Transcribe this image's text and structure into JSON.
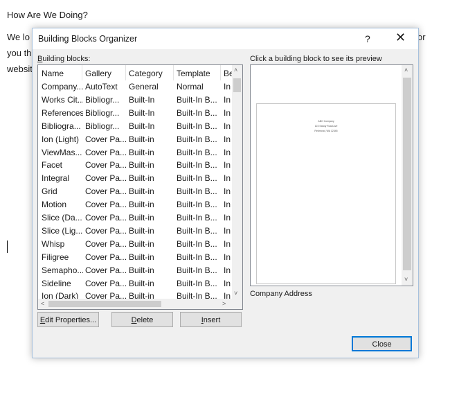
{
  "document": {
    "heading": "How Are We Doing?",
    "line1": "We lo",
    "line1_tail": "or",
    "line2": "you th",
    "line3": "websit"
  },
  "dialog": {
    "title": "Building Blocks Organizer",
    "help": "?",
    "close_glyph": "✕",
    "list_label_key": "B",
    "list_label_rest": "uilding blocks:",
    "preview_label": "Click a building block to see its preview",
    "columns": [
      "Name",
      "Gallery",
      "Category",
      "Template",
      "Be"
    ],
    "rows": [
      [
        "Company...",
        "AutoText",
        "General",
        "Normal",
        "In"
      ],
      [
        "Works Cit...",
        "Bibliogr...",
        "Built-In",
        "Built-In B...",
        "In"
      ],
      [
        "References",
        "Bibliogr...",
        "Built-In",
        "Built-In B...",
        "In"
      ],
      [
        "Bibliogra...",
        "Bibliogr...",
        "Built-In",
        "Built-In B...",
        "In"
      ],
      [
        "Ion (Light)",
        "Cover Pa...",
        "Built-in",
        "Built-In B...",
        "In"
      ],
      [
        "ViewMas...",
        "Cover Pa...",
        "Built-in",
        "Built-In B...",
        "In"
      ],
      [
        "Facet",
        "Cover Pa...",
        "Built-in",
        "Built-In B...",
        "In"
      ],
      [
        "Integral",
        "Cover Pa...",
        "Built-in",
        "Built-In B...",
        "In"
      ],
      [
        "Grid",
        "Cover Pa...",
        "Built-in",
        "Built-In B...",
        "In"
      ],
      [
        "Motion",
        "Cover Pa...",
        "Built-in",
        "Built-In B...",
        "In"
      ],
      [
        "Slice (Da...",
        "Cover Pa...",
        "Built-in",
        "Built-In B...",
        "In"
      ],
      [
        "Slice (Lig...",
        "Cover Pa...",
        "Built-in",
        "Built-In B...",
        "In"
      ],
      [
        "Whisp",
        "Cover Pa...",
        "Built-in",
        "Built-In B...",
        "In"
      ],
      [
        "Filigree",
        "Cover Pa...",
        "Built-in",
        "Built-In B...",
        "In"
      ],
      [
        "Semapho...",
        "Cover Pa...",
        "Built-in",
        "Built-In B...",
        "In"
      ],
      [
        "Sideline",
        "Cover Pa...",
        "Built-in",
        "Built-In B...",
        "In"
      ],
      [
        "Ion (Dark)",
        "Cover Pa...",
        "Built-in",
        "Built-In B...",
        "In"
      ]
    ],
    "preview_page_lines": [
      "ABC Company",
      "123 Sandy Road Ave",
      "Redmond, WA 12345"
    ],
    "preview_name": "Company Address",
    "buttons": {
      "edit_key": "E",
      "edit_rest": "dit Properties...",
      "delete_key": "D",
      "delete_rest": "elete",
      "insert_key": "I",
      "insert_rest": "nsert",
      "close": "Close"
    },
    "arrows": {
      "up": "˄",
      "down": "˅",
      "left": "˂",
      "right": "˃"
    }
  }
}
